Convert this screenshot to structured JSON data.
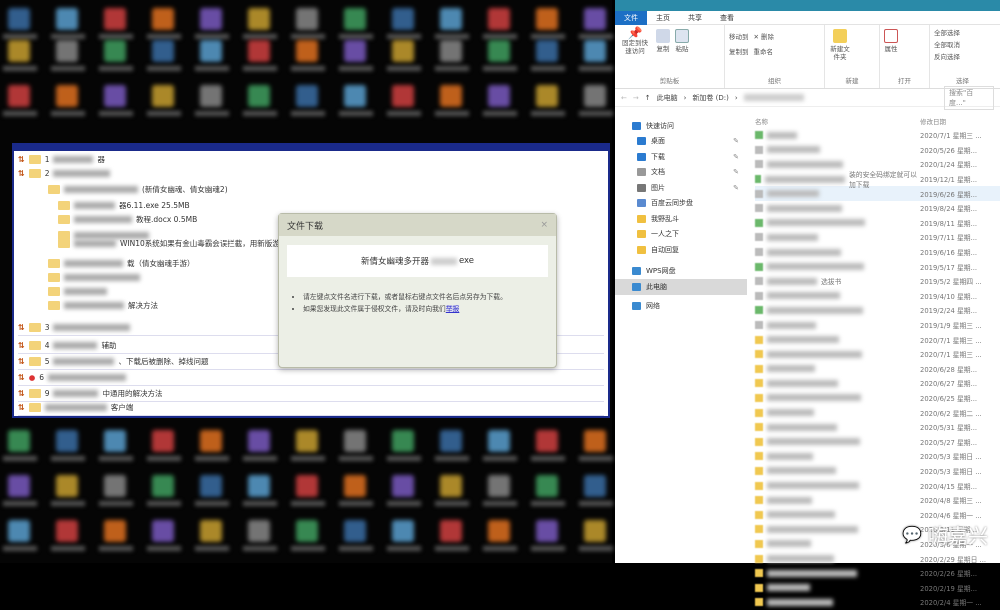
{
  "tree_window": {
    "items": [
      {
        "num": "1",
        "text": "器"
      },
      {
        "num": "2",
        "text": ""
      },
      {
        "num": "",
        "text": "(新倩女幽魂、倩女幽魂2)"
      },
      {
        "num": "",
        "text": "器6.11.exe 25.5MB"
      },
      {
        "num": "",
        "text": "教程.docx 0.5MB"
      },
      {
        "num": "",
        "text": ""
      },
      {
        "num": "",
        "text": "WIN10系统如果有金山毒霸会误拦截，用新版游戏助手或者放下试试"
      },
      {
        "num": "",
        "text": "载（倩女幽魂手游）"
      },
      {
        "num": "",
        "text": ""
      },
      {
        "num": "",
        "text": ""
      },
      {
        "num": "",
        "text": "解决方法"
      },
      {
        "num": "3",
        "text": ""
      },
      {
        "num": "4",
        "text": "辅助"
      },
      {
        "num": "5",
        "text": "、下载后被删除、掉线问题"
      },
      {
        "num": "6",
        "text": ""
      },
      {
        "num": "9",
        "text": "中通用的解决方法"
      },
      {
        "num": "",
        "text": "客户端"
      }
    ]
  },
  "dialog": {
    "title": "文件下载",
    "close": "×",
    "filename": "新倩女幽魂多开器",
    "ext": "exe",
    "tip1": "请左键点文件名进行下载，或者鼠标右键点文件名后点另存为下载。",
    "tip2": "如果您发现此文件属于侵权文件，请及时向我们",
    "report_link": "举报"
  },
  "explorer": {
    "tabs": [
      "文件",
      "主页",
      "共享",
      "查看"
    ],
    "ribbon": {
      "clipboard": {
        "pin": "固定到快速访问",
        "copy": "复制",
        "paste": "粘贴",
        "label": "剪贴板"
      },
      "organize": {
        "move": "移动到",
        "copy_to": "复制到",
        "delete": "删除",
        "rename": "重命名",
        "label": "组织"
      },
      "new": {
        "new_folder": "新建文件夹",
        "label": "新建"
      },
      "open": {
        "properties": "属性",
        "label": "打开"
      },
      "select": {
        "all": "全部选择",
        "none": "全部取消",
        "invert": "反向选择",
        "label": "选择"
      }
    },
    "address": {
      "root": "此电脑",
      "drive": "新加卷 (D:)",
      "search_placeholder": "搜索\"百度...\""
    },
    "columns": {
      "name": "名称",
      "date": "修改日期"
    },
    "nav": [
      {
        "label": "快速访问",
        "pinned": false
      },
      {
        "label": "桌面",
        "pinned": true
      },
      {
        "label": "下载",
        "pinned": true
      },
      {
        "label": "文档",
        "pinned": true
      },
      {
        "label": "图片",
        "pinned": true
      },
      {
        "label": "百度云同步盘",
        "pinned": false
      },
      {
        "label": "我野乱斗",
        "pinned": false
      },
      {
        "label": "一人之下",
        "pinned": false
      },
      {
        "label": "自动回复",
        "pinned": false
      },
      {
        "label": "WPS网盘",
        "pinned": false
      },
      {
        "label": "此电脑",
        "pinned": false
      },
      {
        "label": "网络",
        "pinned": false
      }
    ],
    "files": [
      {
        "name": "",
        "date": "2020/7/1 星期三 ..."
      },
      {
        "name": "",
        "date": "2020/5/26 星期..."
      },
      {
        "name": "",
        "date": "2020/1/24 星期..."
      },
      {
        "name": "装的安全码绑定就可以加下载",
        "date": "2019/12/1 星期..."
      },
      {
        "name": "",
        "date": "2019/6/26 星期..."
      },
      {
        "name": "",
        "date": "2019/8/24 星期..."
      },
      {
        "name": "",
        "date": "2019/8/11 星期..."
      },
      {
        "name": "",
        "date": "2019/7/11 星期..."
      },
      {
        "name": "",
        "date": "2019/6/16 星期..."
      },
      {
        "name": "",
        "date": "2019/5/17 星期..."
      },
      {
        "name": "选拔书",
        "date": "2019/5/2 星期四 ..."
      },
      {
        "name": "",
        "date": "2019/4/10 星期..."
      },
      {
        "name": "",
        "date": "2019/2/24 星期..."
      },
      {
        "name": "",
        "date": "2019/1/9 星期三 ..."
      },
      {
        "name": "",
        "date": "2020/7/1 星期三 ..."
      },
      {
        "name": "",
        "date": "2020/7/1 星期三 ..."
      },
      {
        "name": "",
        "date": "2020/6/28 星期..."
      },
      {
        "name": "",
        "date": "2020/6/27 星期..."
      },
      {
        "name": "",
        "date": "2020/6/25 星期..."
      },
      {
        "name": "",
        "date": "2020/6/2 星期二 ..."
      },
      {
        "name": "",
        "date": "2020/5/31 星期..."
      },
      {
        "name": "",
        "date": "2020/5/27 星期..."
      },
      {
        "name": "",
        "date": "2020/5/3 星期日 ..."
      },
      {
        "name": "",
        "date": "2020/5/3 星期日 ..."
      },
      {
        "name": "",
        "date": "2020/4/15 星期..."
      },
      {
        "name": "",
        "date": "2020/4/8 星期三 ..."
      },
      {
        "name": "",
        "date": "2020/4/6 星期一 ..."
      },
      {
        "name": "",
        "date": "2020/3/11 星期..."
      },
      {
        "name": "",
        "date": "2020/3/6 星期一 ..."
      },
      {
        "name": "",
        "date": "2020/2/29 星期日 ..."
      },
      {
        "name": "",
        "date": "2020/2/26 星期..."
      },
      {
        "name": "",
        "date": "2020/2/19 星期..."
      },
      {
        "name": "",
        "date": "2020/2/4 星期一 ..."
      }
    ]
  },
  "watermark": "嗨嘉兴"
}
